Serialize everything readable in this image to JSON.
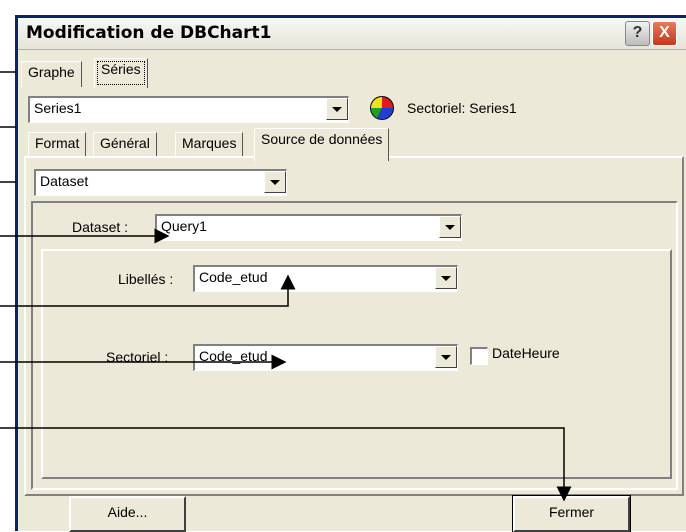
{
  "window": {
    "title": "Modification de DBChart1",
    "help_label": "?",
    "close_label": "X"
  },
  "top_tabs": [
    "Graphe",
    "Séries"
  ],
  "series": {
    "selected": "Series1",
    "type_label": "Sectoriel: Series1"
  },
  "series_tabs": [
    "Format",
    "Général",
    "Marques",
    "Source de données"
  ],
  "source_select": "Dataset",
  "dataset": {
    "label": "Dataset :",
    "value": "Query1"
  },
  "libelles": {
    "label": "Libellés :",
    "value": "Code_etud"
  },
  "sectoriel": {
    "label": "Sectoriel :",
    "value": "Code_etud"
  },
  "dateheure": {
    "label": "DateHeure",
    "checked": false
  },
  "buttons": {
    "help": "Aide...",
    "close": "Fermer"
  },
  "colors": {
    "face": "#ece9d8",
    "title_border": "#0a246a",
    "close_red": "#c4381d"
  },
  "icons": [
    "help-icon",
    "close-icon",
    "pie-chart-icon",
    "dropdown-arrow-icon"
  ]
}
